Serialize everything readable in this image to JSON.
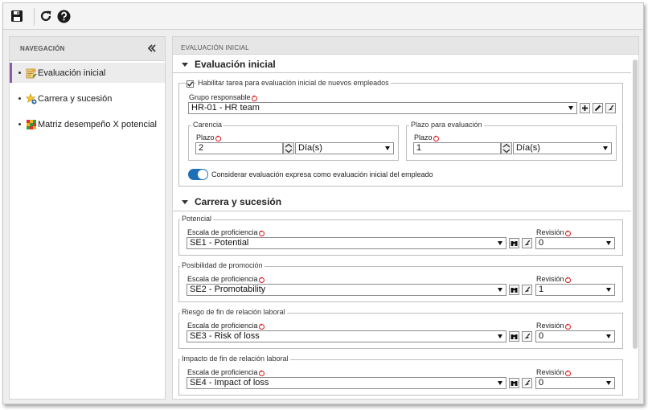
{
  "toolbar": {
    "save_icon": "save-icon",
    "refresh_icon": "refresh-icon",
    "help_icon": "help-icon"
  },
  "nav": {
    "title": "NAVEGACIÓN",
    "collapse_icon": "double-chevron-left-icon",
    "accent": "#8a5ca8",
    "items": [
      {
        "label": "Evaluación inicial",
        "icon": "evaluation-icon",
        "active": true
      },
      {
        "label": "Carrera y sucesión",
        "icon": "career-star-icon",
        "active": false
      },
      {
        "label": "Matriz desempeño X potencial",
        "icon": "matrix-icon",
        "active": false
      }
    ]
  },
  "main": {
    "title": "EVALUACIÓN INICIAL",
    "section1": {
      "title": "Evaluación inicial",
      "enable_checkbox_label": "Habilitar tarea para evaluación inicial de nuevos empleados",
      "enable_checked": true,
      "group_label": "Grupo responsable",
      "group_value": "HR-01 - HR team",
      "carencia": {
        "legend": "Carencia",
        "plazo_label": "Plazo",
        "plazo_value": "2",
        "unit_value": "Día(s)"
      },
      "plazo_evaluacion": {
        "legend": "Plazo para evaluación",
        "plazo_label": "Plazo",
        "plazo_value": "1",
        "unit_value": "Día(s)"
      },
      "toggle_label": "Considerar evaluación expresa como evaluación inicial del empleado",
      "toggle_on": true,
      "toggle_color": "#1f6fb8"
    },
    "section2": {
      "title": "Carrera y sucesión",
      "groups": [
        {
          "legend": "Potencial",
          "scale_label": "Escala de proficiencia",
          "scale_value": "SE1 - Potential",
          "revision_label": "Revisión",
          "revision_value": "0"
        },
        {
          "legend": "Posibilidad de promoción",
          "scale_label": "Escala de proficiencia",
          "scale_value": "SE2 - Promotability",
          "revision_label": "Revisión",
          "revision_value": "1"
        },
        {
          "legend": "Riesgo de fin de relación laboral",
          "scale_label": "Escala de proficiencia",
          "scale_value": "SE3 - Risk of loss",
          "revision_label": "Revisión",
          "revision_value": "0"
        },
        {
          "legend": "Impacto de fin de relación laboral",
          "scale_label": "Escala de proficiencia",
          "scale_value": "SE4 - Impact of loss",
          "revision_label": "Revisión",
          "revision_value": "0"
        }
      ]
    }
  },
  "colors": {
    "required": "#d71a1a"
  }
}
